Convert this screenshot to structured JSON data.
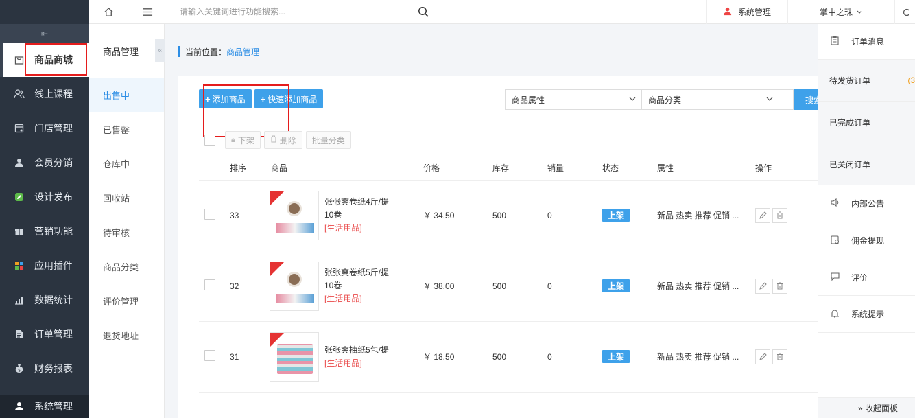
{
  "topbar": {
    "search_placeholder": "请输入关键词进行功能搜索...",
    "system_label": "系统管理",
    "brand": "掌中之珠"
  },
  "leftnav": {
    "items": [
      {
        "label": "商品商城",
        "icon": "bag-icon",
        "active": true
      },
      {
        "label": "线上课程",
        "icon": "users-icon"
      },
      {
        "label": "门店管理",
        "icon": "store-icon"
      },
      {
        "label": "会员分销",
        "icon": "user-icon"
      },
      {
        "label": "设计发布",
        "icon": "leaf-icon"
      },
      {
        "label": "营销功能",
        "icon": "gift-icon"
      },
      {
        "label": "应用插件",
        "icon": "grid-icon"
      },
      {
        "label": "数据统计",
        "icon": "chart-icon"
      },
      {
        "label": "订单管理",
        "icon": "document-icon"
      },
      {
        "label": "财务报表",
        "icon": "money-bag-icon"
      }
    ],
    "bottom": {
      "label": "系统管理",
      "icon": "user-settings-icon"
    }
  },
  "subnav": {
    "title": "商品管理",
    "items": [
      "出售中",
      "已售罄",
      "仓库中",
      "回收站",
      "待审核",
      "商品分类",
      "评价管理",
      "退货地址"
    ]
  },
  "breadcrumb": {
    "prefix": "当前位置：",
    "current": "商品管理"
  },
  "toolbar": {
    "add_label": "添加商品",
    "quick_add_label": "快速添加商品",
    "attr_select": "商品属性",
    "cat_select": "商品分类",
    "search_label": "搜索"
  },
  "bulk": {
    "offshelf": "下架",
    "delete": "删除",
    "batch_category": "批量分类"
  },
  "table": {
    "headers": [
      "排序",
      "商品",
      "价格",
      "库存",
      "销量",
      "状态",
      "属性",
      "操作"
    ],
    "rows": [
      {
        "sort": "33",
        "name": "张张爽卷纸4斤/提10卷",
        "category": "[生活用品]",
        "price": "￥ 34.50",
        "stock": "500",
        "sales": "0",
        "status": "上架",
        "attrs": "新品 热卖 推荐 促销 ..."
      },
      {
        "sort": "32",
        "name": "张张爽卷纸5斤/提10卷",
        "category": "[生活用品]",
        "price": "￥ 38.00",
        "stock": "500",
        "sales": "0",
        "status": "上架",
        "attrs": "新品 热卖 推荐 促销 ..."
      },
      {
        "sort": "31",
        "name": "张张爽抽纸5包/提",
        "category": "[生活用品]",
        "price": "￥ 18.50",
        "stock": "500",
        "sales": "0",
        "status": "上架",
        "attrs": "新品 热卖 推荐 促销 ..."
      }
    ]
  },
  "rpanel": {
    "order_msg": "订单消息",
    "pending": "待发货订单",
    "pending_count": "(3",
    "completed": "已完成订单",
    "closed": "已关闭订单",
    "notice": "内部公告",
    "commission": "佣金提现",
    "review": "评价",
    "system_tip": "系统提示",
    "collapse": "» 收起面板"
  }
}
